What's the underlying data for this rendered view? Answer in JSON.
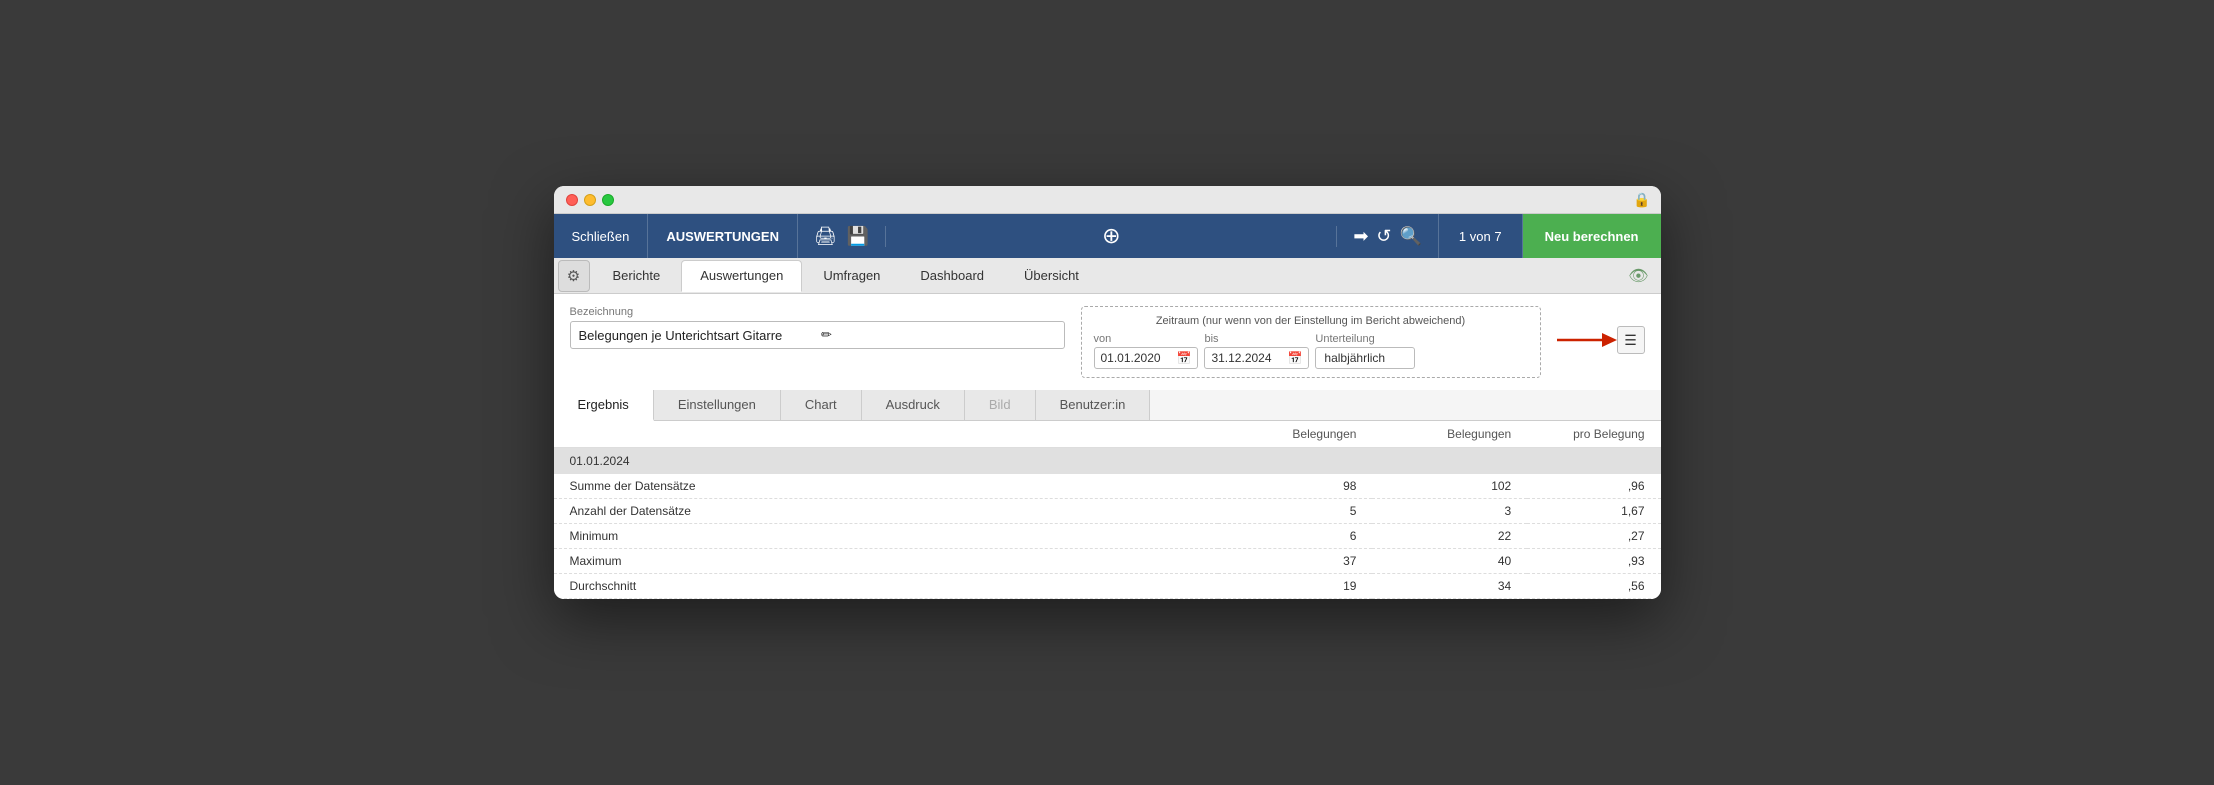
{
  "window": {
    "title": "Auswertungen"
  },
  "titlebar": {
    "lock_icon": "🔒"
  },
  "topnav": {
    "schliessen": "Schließen",
    "auswertungen": "AUSWERTUNGEN",
    "print_icon": "🖨",
    "save_icon": "💾",
    "add_icon": "⊕",
    "arrow_icon": "➡",
    "refresh_icon": "↺",
    "search_icon": "🔍",
    "page_info": "1 von 7",
    "neu_berechnen": "Neu berechnen"
  },
  "tabs": {
    "gear_icon": "⚙",
    "items": [
      {
        "id": "berichte",
        "label": "Berichte",
        "active": false
      },
      {
        "id": "auswertungen",
        "label": "Auswertungen",
        "active": true
      },
      {
        "id": "umfragen",
        "label": "Umfragen",
        "active": false
      },
      {
        "id": "dashboard",
        "label": "Dashboard",
        "active": false
      },
      {
        "id": "uebersicht",
        "label": "Übersicht",
        "active": false
      }
    ],
    "eye_icon": "👁"
  },
  "form": {
    "bezeichnung_label": "Bezeichnung",
    "bezeichnung_value": "Belegungen je Unterichtsart Gitarre",
    "zeitraum_title": "Zeitraum (nur wenn von der Einstellung im Bericht abweichend)",
    "von_label": "von",
    "bis_label": "bis",
    "unterteilung_label": "Unterteilung",
    "von_value": "01.01.2020",
    "bis_value": "31.12.2024",
    "unterteilung_value": "halbjährlich"
  },
  "subtabs": {
    "items": [
      {
        "id": "ergebnis",
        "label": "Ergebnis",
        "active": true
      },
      {
        "id": "einstellungen",
        "label": "Einstellungen",
        "active": false
      },
      {
        "id": "chart",
        "label": "Chart",
        "active": false
      },
      {
        "id": "ausdruck",
        "label": "Ausdruck",
        "active": false
      },
      {
        "id": "bild",
        "label": "Bild",
        "active": false
      },
      {
        "id": "benutzerin",
        "label": "Benutzer:in",
        "active": false
      }
    ]
  },
  "table": {
    "col_spacer": "",
    "col_belegungen1": "Belegungen",
    "col_belegungen2": "Belegungen",
    "col_pro_belegung": "pro Belegung",
    "date_row": "01.01.2024",
    "rows": [
      {
        "label": "Summe der Datensätze",
        "val1": "98",
        "val2": "102",
        "val3": ",96"
      },
      {
        "label": "Anzahl der Datensätze",
        "val1": "5",
        "val2": "3",
        "val3": "1,67"
      },
      {
        "label": "Minimum",
        "val1": "6",
        "val2": "22",
        "val3": ",27"
      },
      {
        "label": "Maximum",
        "val1": "37",
        "val2": "40",
        "val3": ",93"
      },
      {
        "label": "Durchschnitt",
        "val1": "19",
        "val2": "34",
        "val3": ",56"
      }
    ]
  }
}
